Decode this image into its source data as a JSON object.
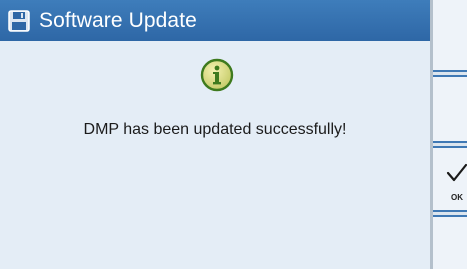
{
  "dialog": {
    "title": "Software Update",
    "title_icon": "save-disk-icon",
    "status_icon": "info-icon",
    "message": "DMP has been updated successfully!"
  },
  "right_panel": {
    "ok_label": "OK",
    "ok_icon": "checkmark-icon"
  },
  "colors": {
    "titlebar": "#2e67a6",
    "background": "#e4edf6",
    "info_icon": "#3e7a1e",
    "separator": "#3f78b4"
  }
}
